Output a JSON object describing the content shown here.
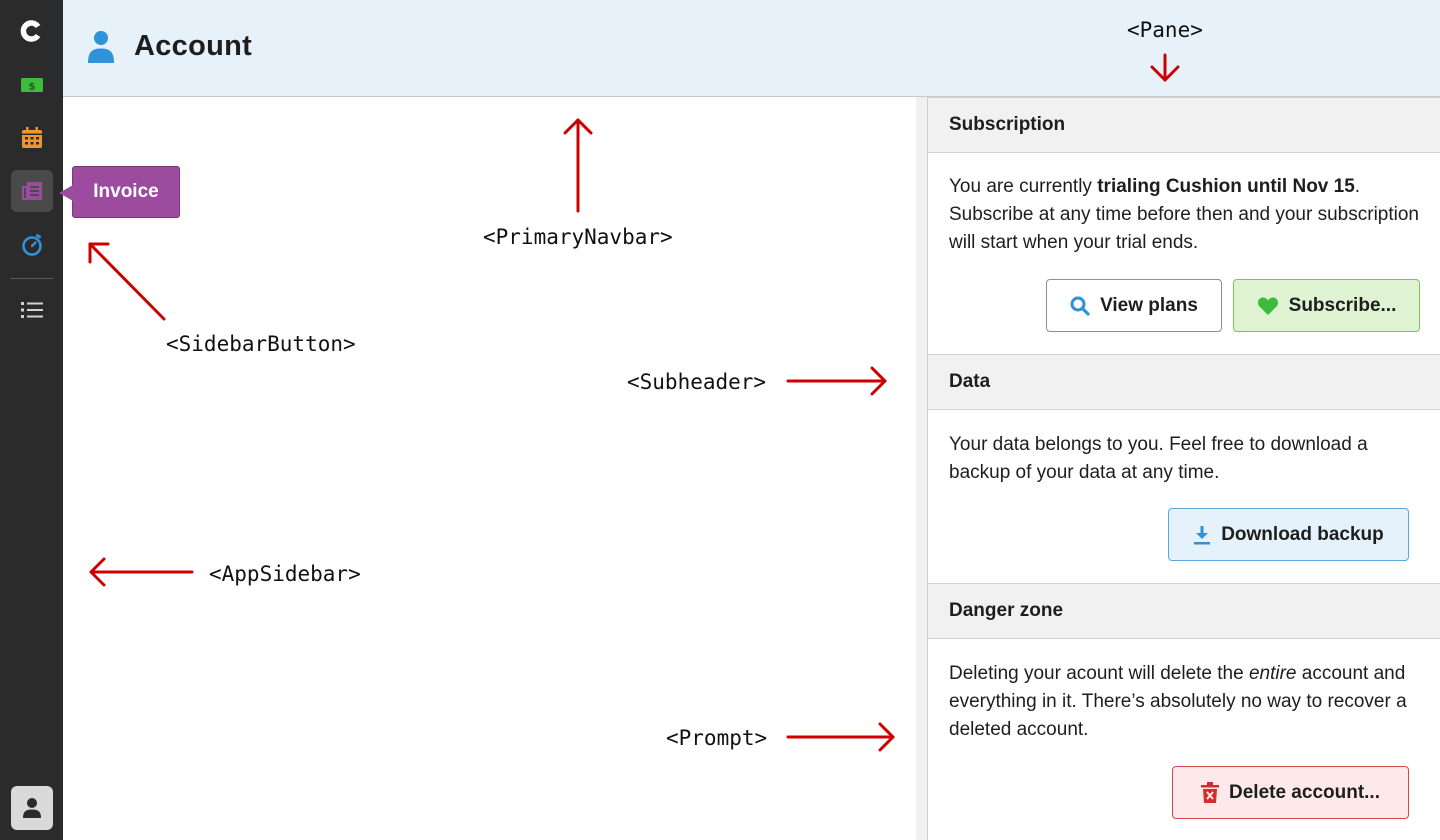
{
  "sidebar": {
    "logo": "c",
    "items": [
      {
        "name": "money-icon",
        "color": "#3dbb3d"
      },
      {
        "name": "calendar-icon",
        "color": "#f0962e"
      },
      {
        "name": "invoice-icon",
        "color": "#9c4b9f"
      },
      {
        "name": "timer-icon",
        "color": "#2e93d8"
      },
      {
        "name": "list-icon",
        "color": "#d0d0d0"
      }
    ],
    "tooltip": "Invoice"
  },
  "navbar": {
    "title": "Account"
  },
  "pane": {
    "subscription": {
      "heading": "Subscription",
      "text_prefix": "You are currently ",
      "text_bold": "trialing Cushion until Nov 15",
      "text_suffix": ". Subscribe at any time before then and your subscription will start when your trial ends.",
      "view_plans_label": "View plans",
      "subscribe_label": "Subscribe..."
    },
    "data": {
      "heading": "Data",
      "text": "Your data belongs to you. Feel free to download a backup of your data at any time.",
      "download_label": "Download backup"
    },
    "danger": {
      "heading": "Danger zone",
      "text_prefix": "Deleting your acount will delete the ",
      "text_italic": "entire",
      "text_suffix": " account and everything in it. There’s absolutely no way to recover a deleted account.",
      "delete_label": "Delete account..."
    }
  },
  "annotations": {
    "pane": "<Pane>",
    "primary_navbar": "<PrimaryNavbar>",
    "sidebar_button": "<SidebarButton>",
    "subheader": "<Subheader>",
    "app_sidebar": "<AppSidebar>",
    "prompt": "<Prompt>"
  },
  "colors": {
    "accent_arrow": "#cc0000",
    "navbar_bg": "#e6f1fa",
    "sidebar_bg": "#2b2b2b"
  }
}
